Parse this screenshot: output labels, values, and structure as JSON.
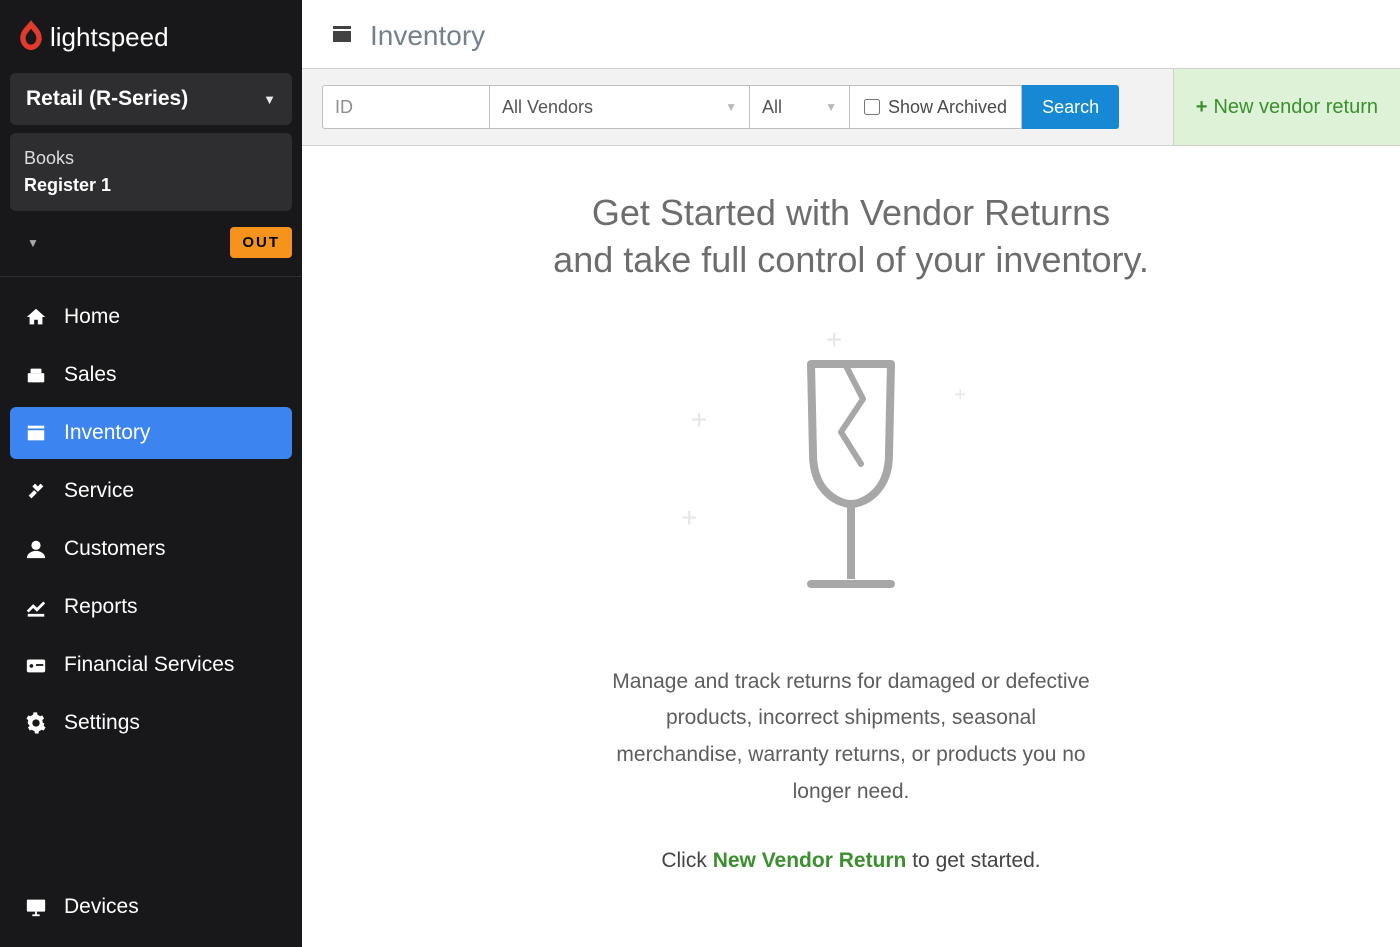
{
  "brand": "lightspeed",
  "sidebar": {
    "product_selector": "Retail (R-Series)",
    "shop": "Books",
    "register": "Register 1",
    "clock_status": "OUT",
    "items": [
      {
        "icon": "home-icon",
        "label": "Home"
      },
      {
        "icon": "sales-icon",
        "label": "Sales"
      },
      {
        "icon": "inventory-icon",
        "label": "Inventory",
        "active": true
      },
      {
        "icon": "service-icon",
        "label": "Service"
      },
      {
        "icon": "customers-icon",
        "label": "Customers"
      },
      {
        "icon": "reports-icon",
        "label": "Reports"
      },
      {
        "icon": "financial-icon",
        "label": "Financial Services"
      },
      {
        "icon": "settings-icon",
        "label": "Settings"
      }
    ],
    "bottom_item": {
      "icon": "devices-icon",
      "label": "Devices"
    }
  },
  "header": {
    "title": "Inventory"
  },
  "filters": {
    "id_placeholder": "ID",
    "vendor_selected": "All Vendors",
    "status_selected": "All",
    "archived_label": "Show Archived",
    "archived_checked": false,
    "search_label": "Search"
  },
  "actions": {
    "new_return_label": "New vendor return"
  },
  "empty_state": {
    "heading_line1": "Get Started with Vendor Returns",
    "heading_line2": "and take full control of your inventory.",
    "description": "Manage and track returns for damaged or defective products, incorrect shipments, seasonal merchandise, warranty returns,  or products you no longer need.",
    "cta_prefix": "Click ",
    "cta_link": "New Vendor Return",
    "cta_suffix": " to get started."
  },
  "colors": {
    "accent_blue": "#3c84f0",
    "action_blue": "#1789d4",
    "green": "#3b8f2f",
    "green_bg": "#def2d7",
    "orange": "#f6931d",
    "brand_red": "#e23b2e"
  }
}
